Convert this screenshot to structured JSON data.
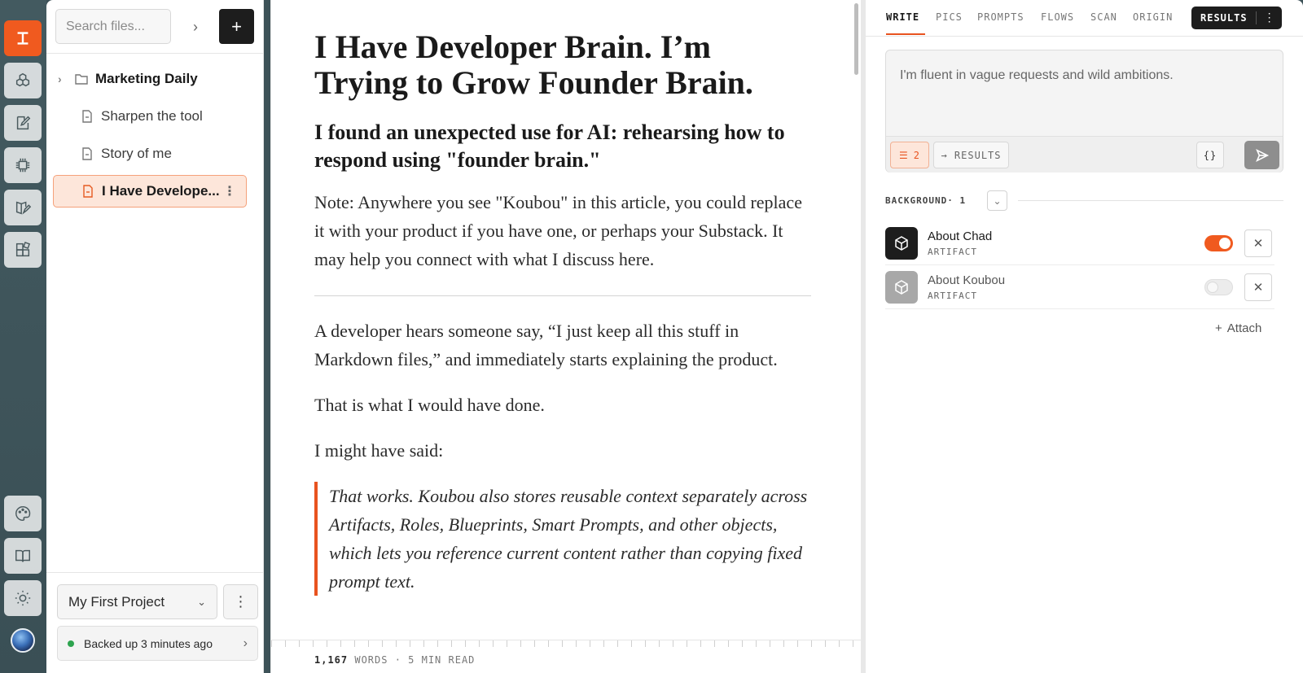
{
  "rail": {
    "icons": [
      "logo-icon",
      "cubes-icon",
      "edit-note-icon",
      "chip-icon",
      "book-pen-icon",
      "blocks-icon",
      "palette-icon",
      "open-book-icon",
      "sun-icon",
      "avatar"
    ]
  },
  "files": {
    "search_placeholder": "Search files...",
    "items": [
      {
        "label": "Marketing Daily",
        "type": "folder"
      },
      {
        "label": "Sharpen the tool",
        "type": "file"
      },
      {
        "label": "Story of me",
        "type": "file"
      },
      {
        "label": "I Have Develope...",
        "type": "file",
        "active": true
      }
    ],
    "project": "My First Project",
    "backup_status": "Backed up 3 minutes ago"
  },
  "editor": {
    "title": "I Have Developer Brain. I’m Trying to Grow Founder Brain.",
    "subtitle": "I found an unexpected use for AI: rehearsing how to respond using \"founder brain.\"",
    "note": "Note: Anywhere you see \"Koubou\" in this article, you could replace it with your product if you have one, or perhaps your Substack. It may help you connect with what I discuss here.",
    "p1": "A developer hears someone say, “I just keep all this stuff in Markdown files,” and immediately starts explaining the product.",
    "p2": "That is what I would have done.",
    "p3": "I might have said:",
    "quote": "That works. Koubou also stores reusable context separately across Artifacts, Roles, Blueprints, Smart Prompts, and other objects, which lets you reference current content rather than copying fixed prompt text.",
    "word_count": "1,167",
    "word_label": "WORDS · 5 MIN READ"
  },
  "right": {
    "tabs": [
      "WRITE",
      "PICS",
      "PROMPTS",
      "FLOWS",
      "SCAN",
      "ORIGIN"
    ],
    "active_tab": "WRITE",
    "results_label": "RESULTS",
    "prompt_text": "I'm fluent in vague requests and wild ambitions.",
    "settings_count": "2",
    "to_results": "→ RESULTS",
    "json_btn": "{}",
    "background_label": "BACKGROUND· 1",
    "artifacts": [
      {
        "name": "About Chad",
        "type": "ARTIFACT",
        "enabled": true
      },
      {
        "name": "About Koubou",
        "type": "ARTIFACT",
        "enabled": false
      }
    ],
    "attach_label": "Attach",
    "accent": "#e8531f"
  }
}
